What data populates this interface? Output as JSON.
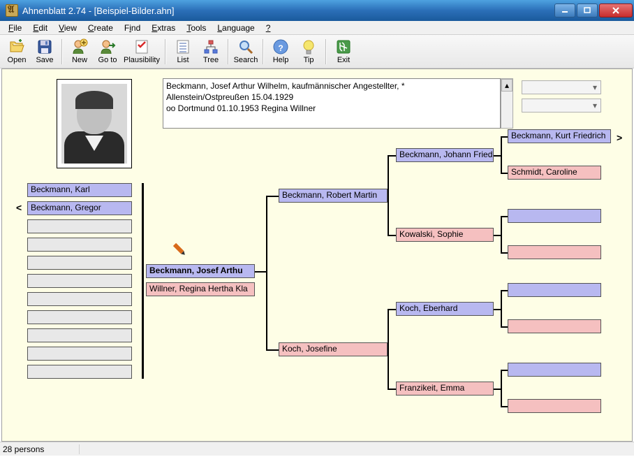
{
  "window": {
    "title": "Ahnenblatt 2.74 - [Beispiel-Bilder.ahn]"
  },
  "menu": {
    "file": "File",
    "edit": "Edit",
    "view": "View",
    "create": "Create",
    "find": "Find",
    "extras": "Extras",
    "tools": "Tools",
    "language": "Language",
    "help": "?"
  },
  "toolbar": {
    "open": "Open",
    "save": "Save",
    "new": "New",
    "goto": "Go to",
    "plausibility": "Plausibility",
    "list": "List",
    "tree": "Tree",
    "search": "Search",
    "help": "Help",
    "tip": "Tip",
    "exit": "Exit"
  },
  "info": {
    "line1": "Beckmann, Josef Arthur Wilhelm, kaufmännischer Angestellter, *",
    "line2": "Allenstein/Ostpreußen 15.04.1929",
    "line3": "oo Dortmund 01.10.1953 Regina Willner"
  },
  "dropdowns": {
    "dd1": "",
    "dd2": ""
  },
  "children": [
    "Beckmann, Karl",
    "Beckmann, Gregor"
  ],
  "proband": {
    "name": "Beckmann, Josef Arthu",
    "spouse": "Willner, Regina Hertha Kla"
  },
  "gen2": {
    "father": "Beckmann, Robert Martin",
    "mother": "Koch, Josefine"
  },
  "gen3": {
    "ff": "Beckmann, Johann Friedr",
    "fm": "Kowalski, Sophie",
    "mf": "Koch, Eberhard",
    "mm": "Franzikeit, Emma"
  },
  "gen4": {
    "top": {
      "f": "Beckmann, Kurt Friedrich",
      "m": "Schmidt, Caroline"
    }
  },
  "status": {
    "persons": "28 persons"
  }
}
